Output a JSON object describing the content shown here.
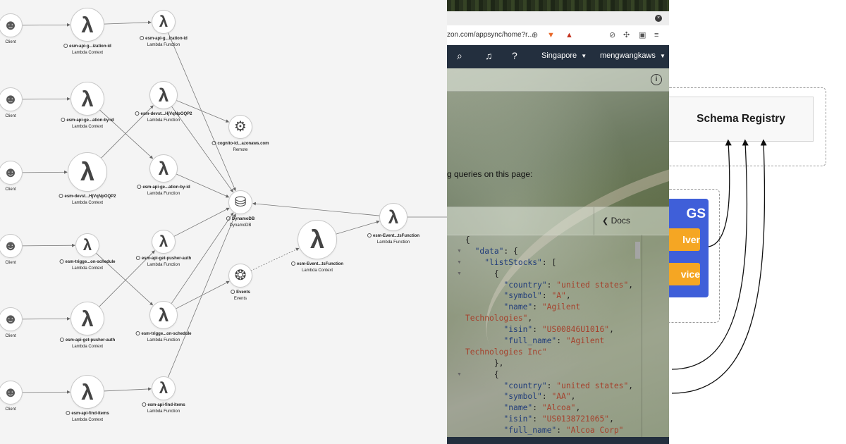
{
  "service_map": {
    "nodes": [
      {
        "id": "client-1",
        "kind": "client",
        "name": "Client",
        "type": "",
        "icon": "person-icon"
      },
      {
        "id": "client-2",
        "kind": "client",
        "name": "Client",
        "type": "",
        "icon": "person-icon"
      },
      {
        "id": "client-3",
        "kind": "client",
        "name": "Client",
        "type": "",
        "icon": "person-icon"
      },
      {
        "id": "client-4",
        "kind": "client",
        "name": "Client",
        "type": "",
        "icon": "person-icon"
      },
      {
        "id": "client-5",
        "kind": "client",
        "name": "Client",
        "type": "",
        "icon": "person-icon"
      },
      {
        "id": "client-6",
        "kind": "client",
        "name": "Client",
        "type": "",
        "icon": "person-icon"
      },
      {
        "id": "ctx-org",
        "kind": "lambda",
        "name": "esm-api-g...ization-id",
        "type": "Lambda Context",
        "icon": "lambda-icon"
      },
      {
        "id": "ctx-loc",
        "kind": "lambda",
        "name": "esm-api-ge...ation-by-id",
        "type": "Lambda Context",
        "icon": "lambda-icon"
      },
      {
        "id": "ctx-devst",
        "kind": "lambda",
        "name": "esm-devst...HjVqNpOQP2",
        "type": "Lambda Context",
        "icon": "lambda-icon"
      },
      {
        "id": "ctx-trigger",
        "kind": "lambda",
        "name": "esm-trigge...on-schedule",
        "type": "Lambda Context",
        "icon": "lambda-icon"
      },
      {
        "id": "ctx-pusher",
        "kind": "lambda",
        "name": "esm-api-get-pusher-auth",
        "type": "Lambda Context",
        "icon": "lambda-icon"
      },
      {
        "id": "ctx-find",
        "kind": "lambda",
        "name": "esm-api-find-items",
        "type": "Lambda Context",
        "icon": "lambda-icon"
      },
      {
        "id": "fn-org",
        "kind": "lambda",
        "name": "esm-api-g...ization-id",
        "type": "Lambda Function",
        "icon": "lambda-icon"
      },
      {
        "id": "fn-devst",
        "kind": "lambda",
        "name": "esm-devst...HjVqNpOQP2",
        "type": "Lambda Function",
        "icon": "lambda-icon"
      },
      {
        "id": "fn-loc",
        "kind": "lambda",
        "name": "esm-api-ge...ation-by-id",
        "type": "Lambda Function",
        "icon": "lambda-icon"
      },
      {
        "id": "fn-pusher",
        "kind": "lambda",
        "name": "esm-api-get-pusher-auth",
        "type": "Lambda Function",
        "icon": "lambda-icon"
      },
      {
        "id": "fn-trigger",
        "kind": "lambda",
        "name": "esm-trigge...on-schedule",
        "type": "Lambda Function",
        "icon": "lambda-icon"
      },
      {
        "id": "fn-find",
        "kind": "lambda",
        "name": "esm-api-find-items",
        "type": "Lambda Function",
        "icon": "lambda-icon"
      },
      {
        "id": "cognito",
        "kind": "remote",
        "name": "cognito-id...azonaws.com",
        "type": "Remote",
        "icon": "gear-icon"
      },
      {
        "id": "dynamodb",
        "kind": "dynamodb",
        "name": "DynamoDB",
        "type": "DynamoDB",
        "icon": "database-icon"
      },
      {
        "id": "events",
        "kind": "events",
        "name": "Events",
        "type": "Events",
        "icon": "events-icon"
      },
      {
        "id": "ctx-event",
        "kind": "lambda",
        "name": "esm-Event...tsFunction",
        "type": "Lambda Context",
        "icon": "lambda-icon"
      },
      {
        "id": "fn-event",
        "kind": "lambda",
        "name": "esm-Event...tsFunction",
        "type": "Lambda Function",
        "icon": "lambda-icon"
      }
    ],
    "edges": [
      [
        "client-1",
        "ctx-org"
      ],
      [
        "client-2",
        "ctx-loc"
      ],
      [
        "client-3",
        "ctx-devst"
      ],
      [
        "client-4",
        "ctx-trigger"
      ],
      [
        "client-5",
        "ctx-pusher"
      ],
      [
        "client-6",
        "ctx-find"
      ],
      [
        "ctx-org",
        "fn-org"
      ],
      [
        "ctx-loc",
        "fn-loc"
      ],
      [
        "ctx-devst",
        "fn-devst"
      ],
      [
        "ctx-trigger",
        "fn-trigger"
      ],
      [
        "ctx-pusher",
        "fn-pusher"
      ],
      [
        "ctx-find",
        "fn-find"
      ],
      [
        "fn-org",
        "dynamodb"
      ],
      [
        "fn-devst",
        "cognito"
      ],
      [
        "fn-devst",
        "dynamodb"
      ],
      [
        "fn-loc",
        "dynamodb"
      ],
      [
        "fn-pusher",
        "dynamodb"
      ],
      [
        "fn-trigger",
        "dynamodb"
      ],
      [
        "fn-trigger",
        "events"
      ],
      [
        "fn-find",
        "dynamodb"
      ],
      [
        "ctx-event",
        "fn-event"
      ],
      [
        "fn-event",
        "dynamodb"
      ]
    ],
    "dashed_edges": [
      [
        "events",
        "ctx-event"
      ]
    ]
  },
  "browser": {
    "url": "zon.com/appsync/home?r...",
    "tab_close_glyph": "×",
    "nav": {
      "search_icon": "search-icon",
      "region": "Singapore",
      "user": "mengwangkaws",
      "dropdown_glyph": "▼"
    },
    "info_glyph": "i",
    "queries_text": "g queries on this page:",
    "docs_label": "Docs",
    "docs_chevron": "❮",
    "result_json": [
      {
        "indent": 0,
        "tokens": [
          {
            "c": "",
            "t": "{"
          }
        ]
      },
      {
        "indent": 1,
        "arrow": true,
        "tokens": [
          {
            "c": "k",
            "t": "\"data\""
          },
          {
            "c": "",
            "t": ": {"
          }
        ]
      },
      {
        "indent": 2,
        "arrow": true,
        "tokens": [
          {
            "c": "k",
            "t": "\"listStocks\""
          },
          {
            "c": "",
            "t": ": ["
          }
        ]
      },
      {
        "indent": 3,
        "arrow": true,
        "tokens": [
          {
            "c": "",
            "t": "{"
          }
        ]
      },
      {
        "indent": 4,
        "tokens": [
          {
            "c": "k",
            "t": "\"country\""
          },
          {
            "c": "",
            "t": ": "
          },
          {
            "c": "s",
            "t": "\"united states\""
          },
          {
            "c": "",
            "t": ","
          }
        ]
      },
      {
        "indent": 4,
        "tokens": [
          {
            "c": "k",
            "t": "\"symbol\""
          },
          {
            "c": "",
            "t": ": "
          },
          {
            "c": "s",
            "t": "\"A\""
          },
          {
            "c": "",
            "t": ","
          }
        ]
      },
      {
        "indent": 4,
        "tokens": [
          {
            "c": "k",
            "t": "\"name\""
          },
          {
            "c": "",
            "t": ": "
          },
          {
            "c": "s",
            "t": "\"Agilent"
          }
        ]
      },
      {
        "indent": 0,
        "tokens": [
          {
            "c": "s",
            "t": "Technologies\""
          },
          {
            "c": "",
            "t": ","
          }
        ]
      },
      {
        "indent": 4,
        "tokens": [
          {
            "c": "k",
            "t": "\"isin\""
          },
          {
            "c": "",
            "t": ": "
          },
          {
            "c": "s",
            "t": "\"US00846U1016\""
          },
          {
            "c": "",
            "t": ","
          }
        ]
      },
      {
        "indent": 4,
        "tokens": [
          {
            "c": "k",
            "t": "\"full_name\""
          },
          {
            "c": "",
            "t": ": "
          },
          {
            "c": "s",
            "t": "\"Agilent"
          }
        ]
      },
      {
        "indent": 0,
        "tokens": [
          {
            "c": "s",
            "t": "Technologies Inc\""
          }
        ]
      },
      {
        "indent": 3,
        "tokens": [
          {
            "c": "",
            "t": "},"
          }
        ]
      },
      {
        "indent": 3,
        "arrow": true,
        "tokens": [
          {
            "c": "",
            "t": "{"
          }
        ]
      },
      {
        "indent": 4,
        "tokens": [
          {
            "c": "k",
            "t": "\"country\""
          },
          {
            "c": "",
            "t": ": "
          },
          {
            "c": "s",
            "t": "\"united states\""
          },
          {
            "c": "",
            "t": ","
          }
        ]
      },
      {
        "indent": 4,
        "tokens": [
          {
            "c": "k",
            "t": "\"symbol\""
          },
          {
            "c": "",
            "t": ": "
          },
          {
            "c": "s",
            "t": "\"AA\""
          },
          {
            "c": "",
            "t": ","
          }
        ]
      },
      {
        "indent": 4,
        "tokens": [
          {
            "c": "k",
            "t": "\"name\""
          },
          {
            "c": "",
            "t": ": "
          },
          {
            "c": "s",
            "t": "\"Alcoa\""
          },
          {
            "c": "",
            "t": ","
          }
        ]
      },
      {
        "indent": 4,
        "tokens": [
          {
            "c": "k",
            "t": "\"isin\""
          },
          {
            "c": "",
            "t": ": "
          },
          {
            "c": "s",
            "t": "\"US0138721065\""
          },
          {
            "c": "",
            "t": ","
          }
        ]
      },
      {
        "indent": 4,
        "tokens": [
          {
            "c": "k",
            "t": "\"full_name\""
          },
          {
            "c": "",
            "t": ": "
          },
          {
            "c": "s",
            "t": "\"Alcoa Corp\""
          }
        ]
      },
      {
        "indent": 3,
        "tokens": [
          {
            "c": "",
            "t": "},"
          }
        ]
      }
    ]
  },
  "architecture": {
    "schema_registry": "Schema Registry",
    "graphql_label": "GS",
    "resolver_label": "lver",
    "service_label": "vice"
  },
  "colors": {
    "aws_nav": "#232f3e",
    "graphql_blue": "#3f5fd9",
    "resolver_orange": "#f5a623",
    "json_key": "#1f3b7a",
    "json_string": "#a5412c"
  }
}
